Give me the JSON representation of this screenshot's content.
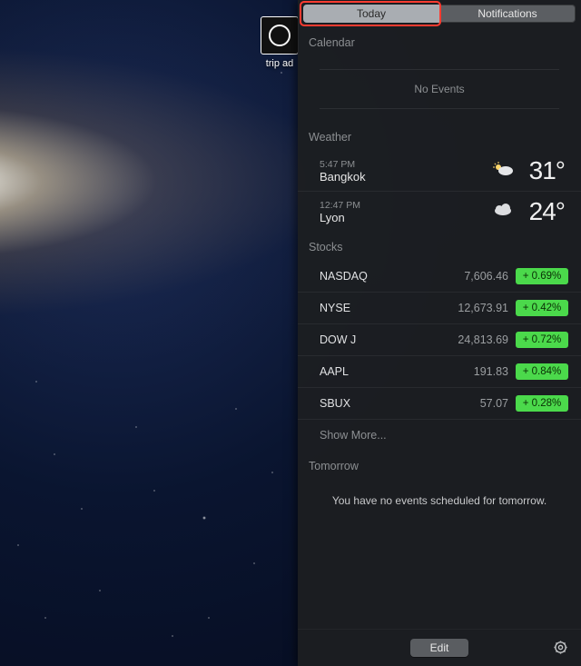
{
  "desktop": {
    "icon_label": "trip ad"
  },
  "tabs": {
    "today": "Today",
    "notifications": "Notifications"
  },
  "calendar": {
    "title": "Calendar",
    "empty": "No Events"
  },
  "weather": {
    "title": "Weather",
    "rows": [
      {
        "time": "5:47 PM",
        "city": "Bangkok",
        "icon": "sun-cloud",
        "temp": "31°"
      },
      {
        "time": "12:47 PM",
        "city": "Lyon",
        "icon": "cloud",
        "temp": "24°"
      }
    ]
  },
  "stocks": {
    "title": "Stocks",
    "rows": [
      {
        "sym": "NASDAQ",
        "val": "7,606.46",
        "chg": "+ 0.69%"
      },
      {
        "sym": "NYSE",
        "val": "12,673.91",
        "chg": "+ 0.42%"
      },
      {
        "sym": "DOW J",
        "val": "24,813.69",
        "chg": "+ 0.72%"
      },
      {
        "sym": "AAPL",
        "val": "191.83",
        "chg": "+ 0.84%"
      },
      {
        "sym": "SBUX",
        "val": "57.07",
        "chg": "+ 0.28%"
      }
    ],
    "show_more": "Show More..."
  },
  "tomorrow": {
    "title": "Tomorrow",
    "text": "You have no events scheduled for tomorrow."
  },
  "footer": {
    "edit": "Edit"
  }
}
